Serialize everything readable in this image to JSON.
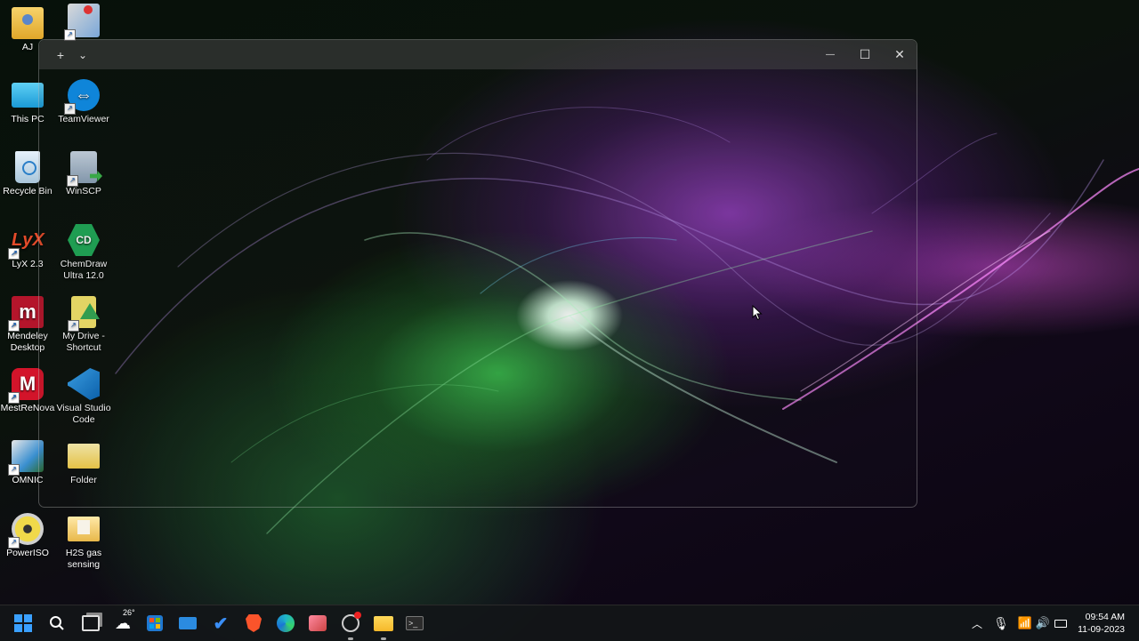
{
  "desktop": {
    "icons": [
      {
        "label": "AJ",
        "icon": "user-folder-icon"
      },
      {
        "label": "",
        "icon": "installer-icon"
      },
      {
        "label": "This PC",
        "icon": "monitor-icon"
      },
      {
        "label": "TeamViewer",
        "icon": "teamviewer-icon"
      },
      {
        "label": "Recycle Bin",
        "icon": "recycle-bin-icon"
      },
      {
        "label": "WinSCP",
        "icon": "winscp-icon"
      },
      {
        "label": "LyX 2.3",
        "icon": "lyx-icon"
      },
      {
        "label": "ChemDraw Ultra 12.0",
        "icon": "chemdraw-icon"
      },
      {
        "label": "Mendeley Desktop",
        "icon": "mendeley-icon"
      },
      {
        "label": "My Drive - Shortcut",
        "icon": "google-drive-icon"
      },
      {
        "label": "MestReNova",
        "icon": "mestrenova-icon"
      },
      {
        "label": "Visual Studio Code",
        "icon": "vscode-icon"
      },
      {
        "label": "OMNIC",
        "icon": "omnic-icon"
      },
      {
        "label": "Folder",
        "icon": "folder-icon"
      },
      {
        "label": "PowerISO",
        "icon": "poweriso-icon"
      },
      {
        "label": "H2S gas sensing",
        "icon": "folder-icon"
      }
    ]
  },
  "window": {
    "new_tab": "+",
    "dropdown": "⌄",
    "minimize": "—",
    "maximize": "☐",
    "close": "✕"
  },
  "taskbar": {
    "weather_temp": "26°",
    "time": "09:54 AM",
    "date": "11-09-2023",
    "colors": {
      "start": "#3aa0ff",
      "brave": "#fb542b",
      "edge": "#1fb5c8",
      "folder": "#f5c842"
    }
  }
}
